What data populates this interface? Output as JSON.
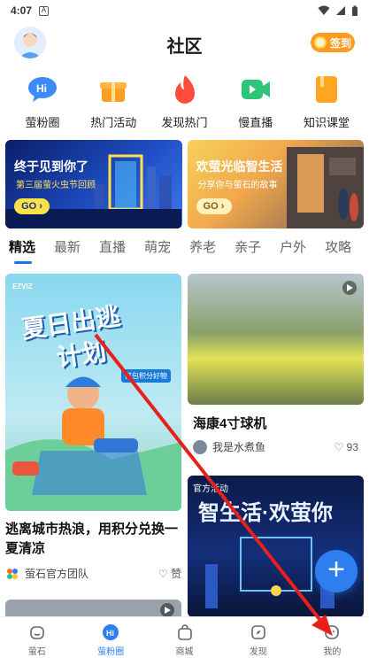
{
  "status_bar": {
    "time": "4:07"
  },
  "header": {
    "title": "社区",
    "checkin_label": "签到"
  },
  "quick_links": [
    {
      "label": "萤粉圈",
      "color": "#3b8cf5"
    },
    {
      "label": "热门活动",
      "color": "#ff9d1c"
    },
    {
      "label": "发现热门",
      "color": "#ff4b3a"
    },
    {
      "label": "慢直播",
      "color": "#2ec57a"
    },
    {
      "label": "知识课堂",
      "color": "#ffa51f"
    }
  ],
  "banners": [
    {
      "title": "终于见到你了",
      "subtitle": "第三届萤火虫节回顾",
      "go": "GO"
    },
    {
      "title": "欢萤光临智生活",
      "subtitle": "分享你与萤石的故事",
      "go": "GO"
    }
  ],
  "tabs": [
    "精选",
    "最新",
    "直播",
    "萌宠",
    "养老",
    "亲子",
    "户外",
    "攻略"
  ],
  "feed": {
    "left_card": {
      "brand": "EZVIZ",
      "art_line1": "夏日出逃",
      "art_line2": "计划",
      "art_pill": "打包积分好物",
      "title": "逃离城市热浪，用积分兑换一夏清凉",
      "author": "萤石官方团队",
      "likes": "赞"
    },
    "right_card": {
      "title": "海康4寸球机",
      "author": "我是水煮鱼",
      "likes": "93"
    },
    "promo_card": {
      "tag": "官方活动",
      "heading": "智生活·欢萤你"
    }
  },
  "fab": {
    "label": "+"
  },
  "bottom_nav": [
    {
      "label": "萤石",
      "active": false
    },
    {
      "label": "萤粉圈",
      "active": true
    },
    {
      "label": "商城",
      "active": false
    },
    {
      "label": "发现",
      "active": false
    },
    {
      "label": "我的",
      "active": false
    }
  ]
}
